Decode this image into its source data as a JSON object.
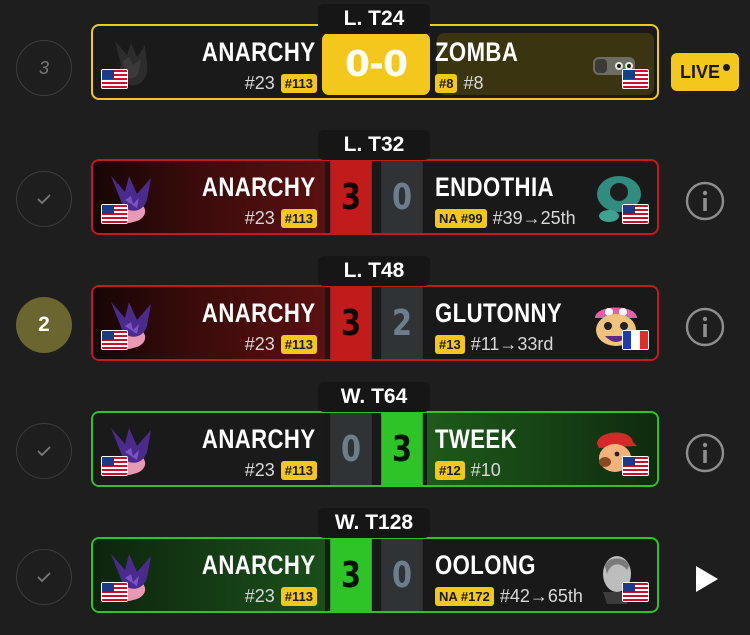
{
  "matches": [
    {
      "status_value": "3",
      "round": "L. T24",
      "player": {
        "name": "ANARCHY",
        "rank": "#23",
        "badge": "#113",
        "flag": "US"
      },
      "score_text": "0-0",
      "opponent": {
        "name": "ZOMBA",
        "badge": "#8",
        "rank": "#8",
        "flag": "US"
      },
      "action_label": "LIVE",
      "action_icon": "live-dot-icon"
    },
    {
      "status_icon": "check-icon",
      "round": "L. T32",
      "player": {
        "name": "ANARCHY",
        "rank": "#23",
        "badge": "#113",
        "flag": "US"
      },
      "score": {
        "player": "3",
        "opponent": "0"
      },
      "opponent": {
        "name": "ENDOTHIA",
        "badge": "NA #99",
        "rank": "#39→25th",
        "flag": "US"
      },
      "action_icon": "info-icon"
    },
    {
      "status_value": "2",
      "round": "L. T48",
      "player": {
        "name": "ANARCHY",
        "rank": "#23",
        "badge": "#113",
        "flag": "US"
      },
      "score": {
        "player": "3",
        "opponent": "2"
      },
      "opponent": {
        "name": "GLUTONNY",
        "badge": "#13",
        "rank": "#11→33rd",
        "flag": "FR"
      },
      "action_icon": "info-icon"
    },
    {
      "status_icon": "check-icon",
      "round": "W. T64",
      "player": {
        "name": "ANARCHY",
        "rank": "#23",
        "badge": "#113",
        "flag": "US"
      },
      "score": {
        "player": "0",
        "opponent": "3"
      },
      "opponent": {
        "name": "TWEEK",
        "badge": "#12",
        "rank": "#10",
        "flag": "US"
      },
      "action_icon": "info-icon"
    },
    {
      "status_icon": "check-icon",
      "round": "W. T128",
      "player": {
        "name": "ANARCHY",
        "rank": "#23",
        "badge": "#113",
        "flag": "US"
      },
      "score": {
        "player": "3",
        "opponent": "0"
      },
      "opponent": {
        "name": "OOLONG",
        "badge": "NA #172",
        "rank": "#42→65th",
        "flag": "US"
      },
      "action_icon": "play-icon"
    }
  ],
  "colors": {
    "live": "#f3c71c",
    "loss": "#c21b1b",
    "win": "#2ec327",
    "background": "#1e1e1e"
  }
}
